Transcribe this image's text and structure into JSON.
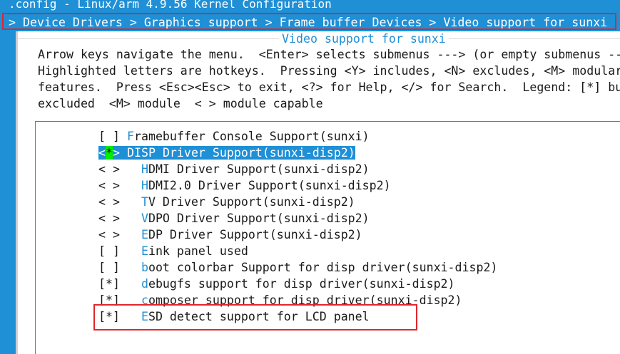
{
  "window": {
    "title": ".config - Linux/arm 4.9.56 Kernel Configuration",
    "breadcrumb": "> Device Drivers > Graphics support > Frame buffer Devices > Video support for sunxi"
  },
  "dialog": {
    "title": "Video support for sunxi",
    "help_lines": [
      "Arrow keys navigate the menu.  <Enter> selects submenus ---> (or empty submenus --",
      "Highlighted letters are hotkeys.  Pressing <Y> includes, <N> excludes, <M> modular",
      "features.  Press <Esc><Esc> to exit, <?> for Help, </> for Search.  Legend: [*] bu",
      "excluded  <M> module  < > module capable"
    ]
  },
  "menu": {
    "items": [
      {
        "prefix": "[ ] ",
        "indent": "",
        "hotkey": "F",
        "rest": "ramebuffer Console Support(sunxi)"
      },
      {
        "prefix_open": "<",
        "state": "*",
        "prefix_close": "> ",
        "indent": "",
        "hotkey": "D",
        "rest": "ISP Driver Support(sunxi-disp2)",
        "selected": true
      },
      {
        "prefix": "< > ",
        "indent": "  ",
        "hotkey": "H",
        "rest": "DMI Driver Support(sunxi-disp2)"
      },
      {
        "prefix": "< > ",
        "indent": "  ",
        "hotkey": "H",
        "rest": "DMI2.0 Driver Support(sunxi-disp2)"
      },
      {
        "prefix": "< > ",
        "indent": "  ",
        "hotkey": "T",
        "rest": "V Driver Support(sunxi-disp2)"
      },
      {
        "prefix": "< > ",
        "indent": "  ",
        "hotkey": "V",
        "rest": "DPO Driver Support(sunxi-disp2)"
      },
      {
        "prefix": "< > ",
        "indent": "  ",
        "hotkey": "E",
        "rest": "DP Driver Support(sunxi-disp2)"
      },
      {
        "prefix": "[ ] ",
        "indent": "  ",
        "hotkey": "E",
        "rest": "ink panel used"
      },
      {
        "prefix": "[ ] ",
        "indent": "  ",
        "hotkey": "b",
        "rest": "oot colorbar Support for disp driver(sunxi-disp2)"
      },
      {
        "prefix": "[*] ",
        "indent": "  ",
        "hotkey": "d",
        "rest": "ebugfs support for disp driver(sunxi-disp2)"
      },
      {
        "prefix": "[*] ",
        "indent": "  ",
        "hotkey": "c",
        "rest": "omposer support for disp driver(sunxi-disp2)"
      },
      {
        "prefix": "[*] ",
        "indent": "  ",
        "hotkey": "E",
        "rest": "SD detect support for LCD panel"
      }
    ]
  }
}
